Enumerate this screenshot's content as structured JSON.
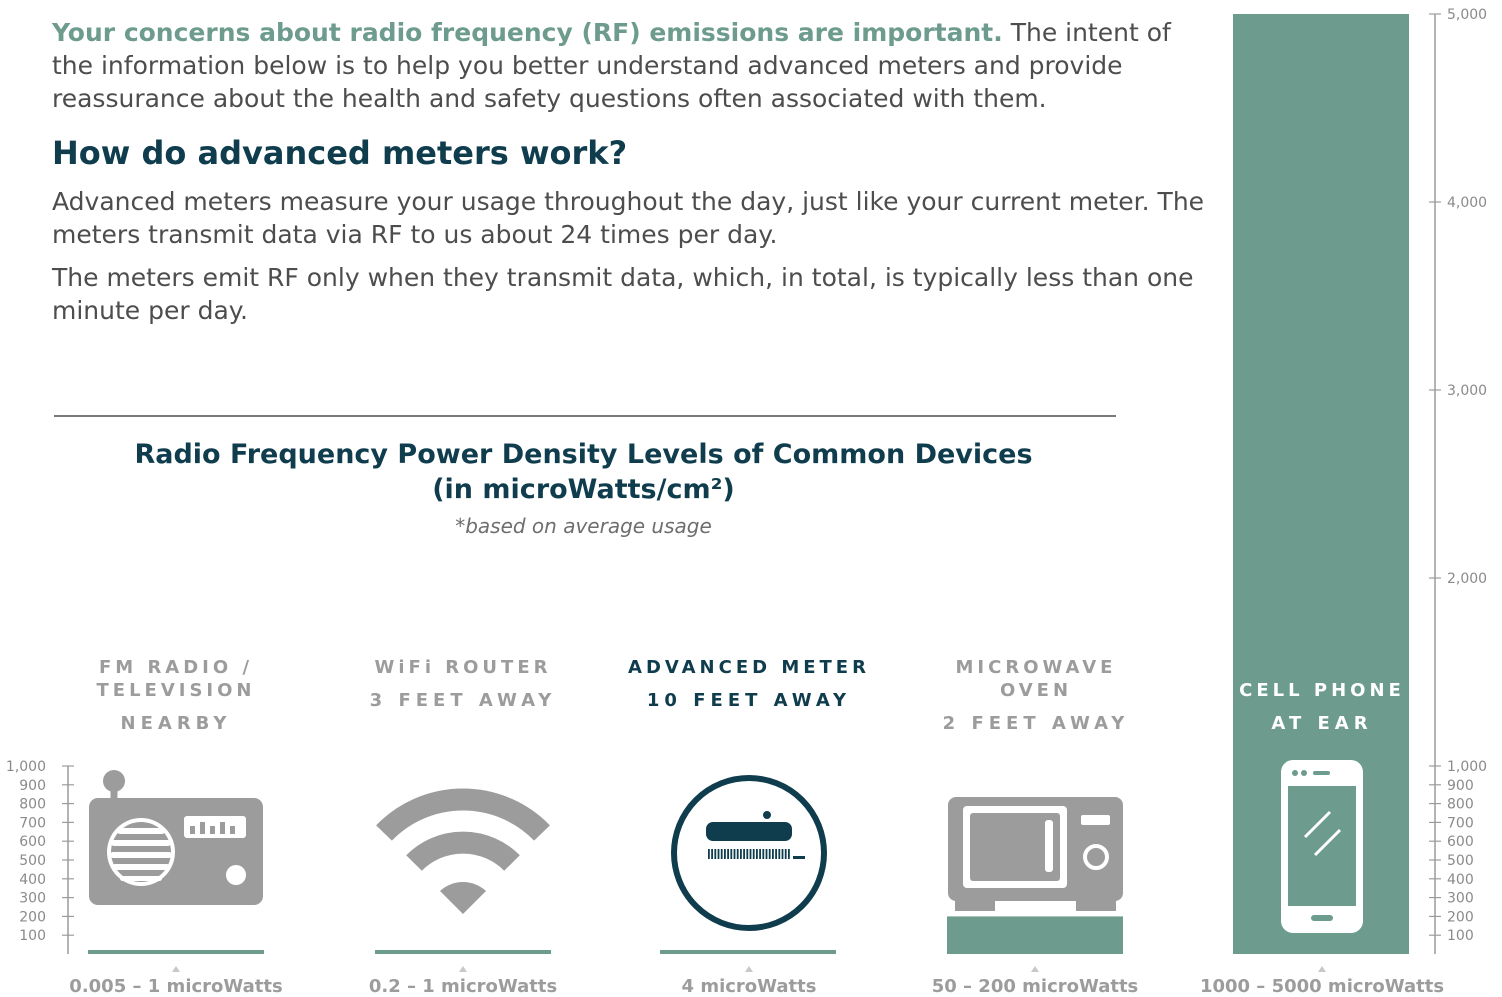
{
  "intro": {
    "lead": "Your concerns about radio frequency (RF) emissions are important.",
    "text": " The intent of the information below is to help you better understand advanced meters and provide reassurance about the health and safety questions often associated with them."
  },
  "heading": "How do advanced meters work?",
  "paragraphs": [
    "Advanced meters measure your usage throughout the day, just like your current meter. The meters transmit data via RF to us about 24 times per day.",
    "The meters emit RF only when they transmit data, which, in total, is typically less than one minute per day."
  ],
  "colors": {
    "accent": "#6d9c8e",
    "navy": "#0f3d4d",
    "gray": "#9c9c9c"
  },
  "chart_data": {
    "type": "bar",
    "title": "Radio Frequency Power Density Levels of Common Devices",
    "title_units": "(in microWatts/cm²)",
    "note": "*based on average usage",
    "left_axis": {
      "ticks": [
        "100",
        "200",
        "300",
        "400",
        "500",
        "600",
        "700",
        "800",
        "900",
        "1,000"
      ],
      "ylim": [
        0,
        1000
      ]
    },
    "right_axis": {
      "ticks": [
        "100",
        "200",
        "300",
        "400",
        "500",
        "600",
        "700",
        "800",
        "900",
        "1,000",
        "2,000",
        "3,000",
        "4,000",
        "5,000"
      ],
      "ylim": [
        0,
        5000
      ]
    },
    "devices": [
      {
        "name": "FM RADIO / TELEVISION",
        "distance": "NEARBY",
        "range": "0.005 – 1 microWatts",
        "value": 1,
        "icon": "radio-icon"
      },
      {
        "name": "WiFi ROUTER",
        "distance": "3 FEET AWAY",
        "range": "0.2 – 1 microWatts",
        "value": 1,
        "icon": "wifi-icon"
      },
      {
        "name": "ADVANCED METER",
        "distance": "10 FEET AWAY",
        "range": "4 microWatts",
        "value": 4,
        "icon": "meter-icon",
        "highlight": true
      },
      {
        "name": "MICROWAVE OVEN",
        "distance": "2 FEET AWAY",
        "range": "50 – 200 microWatts",
        "value": 200,
        "icon": "microwave-icon"
      },
      {
        "name": "CELL PHONE",
        "distance": "AT EAR",
        "range": "1000 – 5000 microWatts",
        "value": 5000,
        "icon": "cell-phone-icon"
      }
    ]
  }
}
